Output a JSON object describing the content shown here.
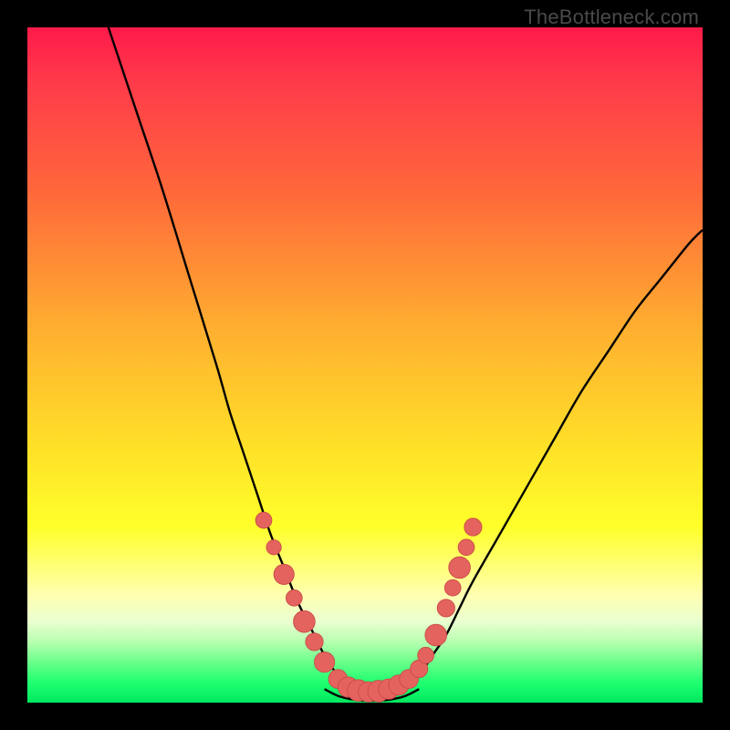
{
  "watermark": "TheBottleneck.com",
  "chart_data": {
    "type": "line",
    "title": "",
    "xlabel": "",
    "ylabel": "",
    "xlim": [
      0,
      100
    ],
    "ylim": [
      0,
      100
    ],
    "series": [
      {
        "name": "left-curve",
        "x": [
          12,
          16,
          20,
          24,
          28,
          30,
          32,
          34,
          36,
          38,
          40,
          42,
          44,
          46,
          48
        ],
        "y": [
          100,
          88,
          76,
          63,
          50,
          43,
          37,
          31,
          25,
          20,
          15,
          11,
          7,
          4,
          2
        ]
      },
      {
        "name": "right-curve",
        "x": [
          56,
          58,
          60,
          62,
          64,
          66,
          70,
          74,
          78,
          82,
          86,
          90,
          94,
          98,
          100
        ],
        "y": [
          2,
          4,
          7,
          10,
          14,
          18,
          25,
          32,
          39,
          46,
          52,
          58,
          63,
          68,
          70
        ]
      },
      {
        "name": "valley-floor",
        "x": [
          44,
          46,
          48,
          50,
          52,
          54,
          56,
          58
        ],
        "y": [
          2,
          1,
          0.5,
          0.3,
          0.3,
          0.5,
          1,
          2
        ]
      }
    ],
    "markers": [
      {
        "x": 35,
        "y": 27,
        "r": 1.2
      },
      {
        "x": 36.5,
        "y": 23,
        "r": 1.1
      },
      {
        "x": 38,
        "y": 19,
        "r": 1.5
      },
      {
        "x": 39.5,
        "y": 15.5,
        "r": 1.2
      },
      {
        "x": 41,
        "y": 12,
        "r": 1.6
      },
      {
        "x": 42.5,
        "y": 9,
        "r": 1.3
      },
      {
        "x": 44,
        "y": 6,
        "r": 1.5
      },
      {
        "x": 46,
        "y": 3.5,
        "r": 1.4
      },
      {
        "x": 47.5,
        "y": 2.3,
        "r": 1.5
      },
      {
        "x": 49,
        "y": 1.8,
        "r": 1.6
      },
      {
        "x": 50.5,
        "y": 1.6,
        "r": 1.5
      },
      {
        "x": 52,
        "y": 1.7,
        "r": 1.6
      },
      {
        "x": 53.5,
        "y": 2.0,
        "r": 1.5
      },
      {
        "x": 55,
        "y": 2.6,
        "r": 1.5
      },
      {
        "x": 56.5,
        "y": 3.5,
        "r": 1.4
      },
      {
        "x": 58,
        "y": 5,
        "r": 1.3
      },
      {
        "x": 59,
        "y": 7,
        "r": 1.2
      },
      {
        "x": 60.5,
        "y": 10,
        "r": 1.6
      },
      {
        "x": 62,
        "y": 14,
        "r": 1.3
      },
      {
        "x": 63,
        "y": 17,
        "r": 1.2
      },
      {
        "x": 64,
        "y": 20,
        "r": 1.6
      },
      {
        "x": 65,
        "y": 23,
        "r": 1.2
      },
      {
        "x": 66,
        "y": 26,
        "r": 1.3
      }
    ],
    "colors": {
      "curve": "#000000",
      "marker_fill": "#e4635f",
      "marker_stroke": "#c94b47"
    }
  }
}
